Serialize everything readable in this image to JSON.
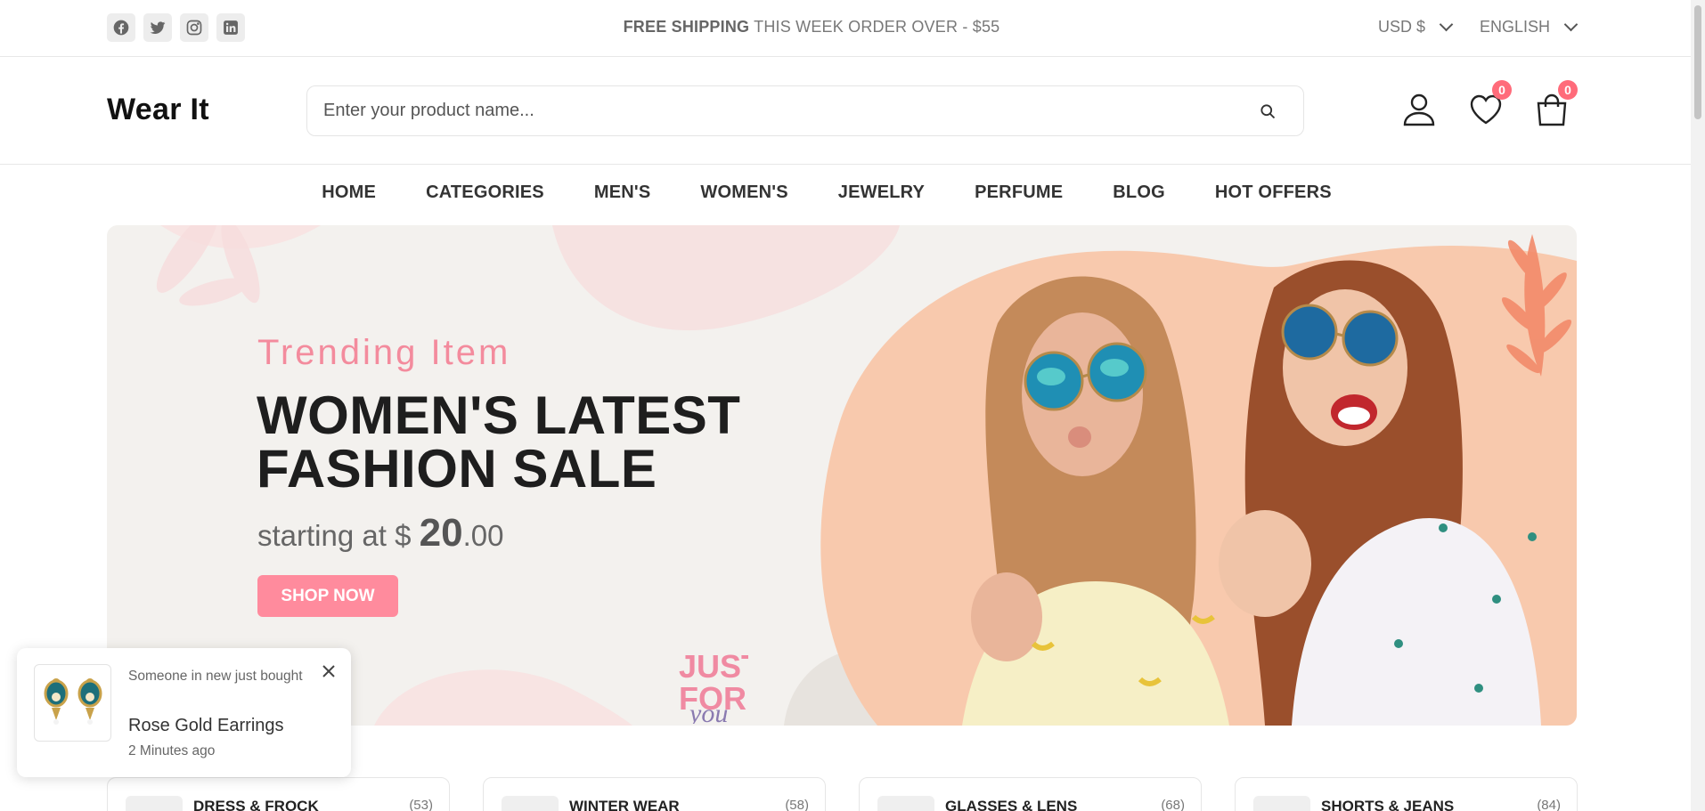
{
  "topbar": {
    "social": [
      "facebook-icon",
      "twitter-icon",
      "instagram-icon",
      "linkedin-icon"
    ],
    "shipping_bold": "FREE SHIPPING",
    "shipping_rest": " THIS WEEK ORDER OVER - $55",
    "currency": "USD $",
    "language": "ENGLISH"
  },
  "header": {
    "logo": "Wear It",
    "search_placeholder": "Enter your product name...",
    "wishlist_count": "0",
    "cart_count": "0"
  },
  "nav": {
    "items": [
      "HOME",
      "CATEGORIES",
      "MEN'S",
      "WOMEN'S",
      "JEWELRY",
      "PERFUME",
      "BLOG",
      "HOT OFFERS"
    ]
  },
  "banner": {
    "subtitle": "Trending Item",
    "title_line1": "WOMEN'S LATEST",
    "title_line2": "FASHION SALE",
    "price_prefix": "starting at $ ",
    "price_whole": "20",
    "price_cents": ".00",
    "cta": "SHOP NOW",
    "badge_line1": "JUST",
    "badge_line2": "FOR",
    "badge_line3": "you"
  },
  "toast": {
    "message": "Someone in new just bought",
    "product": "Rose Gold Earrings",
    "time": "2 Minutes ago"
  },
  "categories": [
    {
      "name": "DRESS & FROCK",
      "count": "(53)"
    },
    {
      "name": "WINTER WEAR",
      "count": "(58)"
    },
    {
      "name": "GLASSES & LENS",
      "count": "(68)"
    },
    {
      "name": "SHORTS & JEANS",
      "count": "(84)"
    }
  ],
  "colors": {
    "accent": "#ff8b9d",
    "badge": "#ff6b7a",
    "banner_bg": "#f3f1ee",
    "peach": "#f8c9ad"
  }
}
